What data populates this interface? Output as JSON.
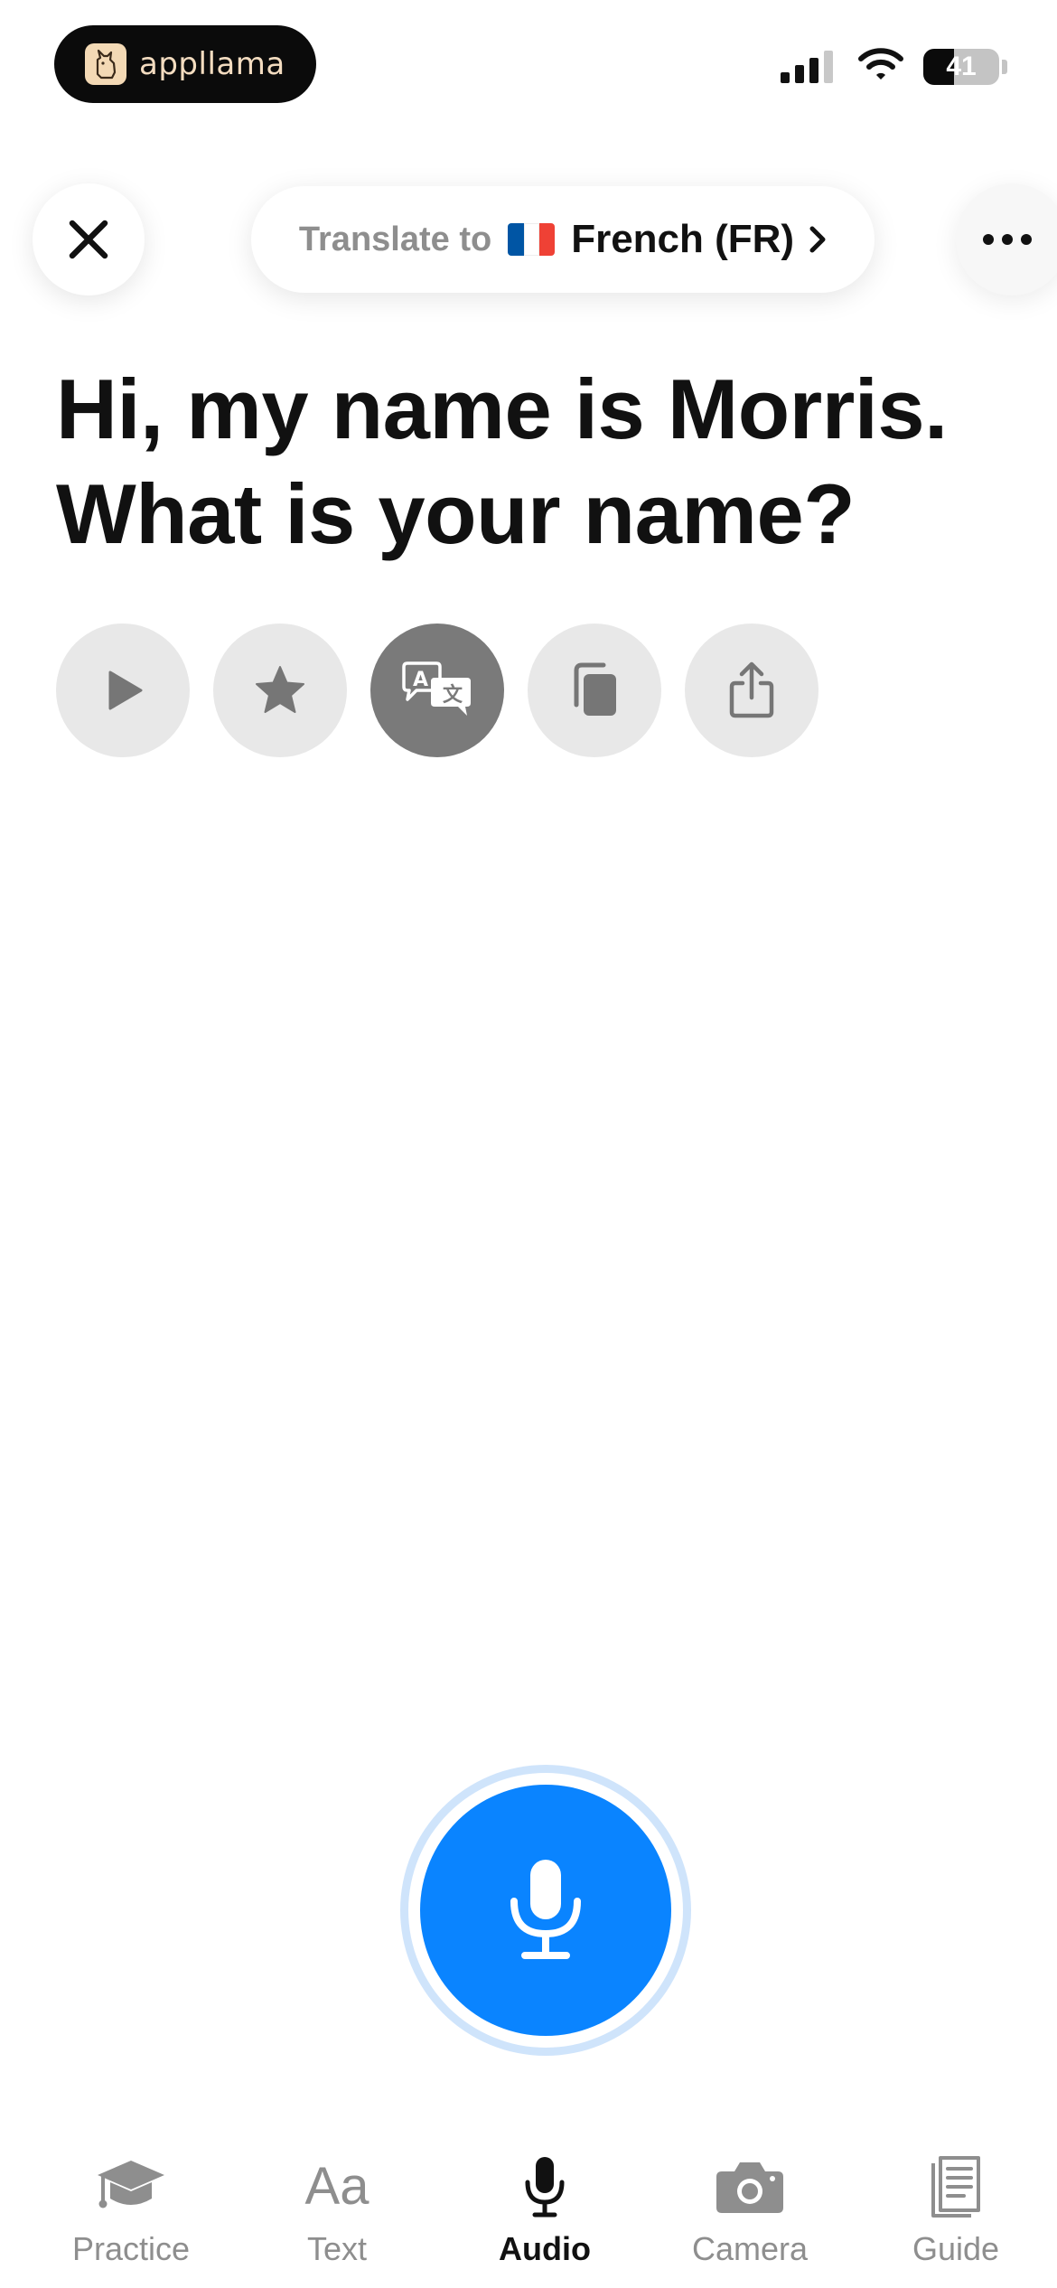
{
  "status_bar": {
    "app_name": "appllama",
    "battery_percent": "41",
    "battery_level": 0.41,
    "signal_bars": 4,
    "signal_bars_active": 3
  },
  "header": {
    "translate_prefix": "Translate to",
    "language": "French (FR)",
    "flag_colors": [
      "#0055A4",
      "#FFFFFF",
      "#EF4135"
    ]
  },
  "phrase": {
    "line1": "Hi, my name is Morris.",
    "line2": "What is your name?"
  },
  "actions": [
    {
      "name": "play",
      "icon": "play-icon",
      "active": false
    },
    {
      "name": "favorite",
      "icon": "star-icon",
      "active": false
    },
    {
      "name": "translate",
      "icon": "translate-icon",
      "active": true
    },
    {
      "name": "copy",
      "icon": "copy-icon",
      "active": false
    },
    {
      "name": "share",
      "icon": "share-icon",
      "active": false
    }
  ],
  "mic": {
    "icon": "microphone-icon",
    "color": "#0A84FF"
  },
  "tabs": [
    {
      "label": "Practice",
      "icon": "graduation-cap-icon",
      "active": false
    },
    {
      "label": "Text",
      "icon": "Aa",
      "active": false
    },
    {
      "label": "Audio",
      "icon": "microphone-icon",
      "active": true
    },
    {
      "label": "Camera",
      "icon": "camera-icon",
      "active": false
    },
    {
      "label": "Guide",
      "icon": "book-icon",
      "active": false
    }
  ]
}
